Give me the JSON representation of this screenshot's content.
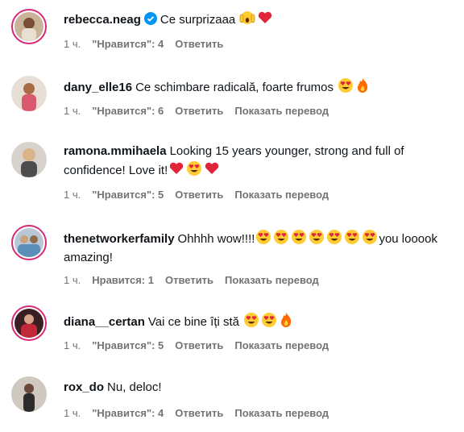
{
  "comments": [
    {
      "username": "rebecca.neag",
      "verified": true,
      "text": "Ce surprizaaa",
      "emojis": [
        "screaming-hands",
        "red-heart"
      ],
      "time": "1 ч.",
      "likes": "\"Нравится\": 4",
      "reply": "Ответить",
      "translate": ""
    },
    {
      "username": "dany_elle16",
      "text": "Ce schimbare radicală, foarte frumos",
      "emojis": [
        "heart-eyes",
        "fire"
      ],
      "time": "1 ч.",
      "likes": "\"Нравится\": 6",
      "reply": "Ответить",
      "translate": "Показать перевод"
    },
    {
      "username": "ramona.mmihaela",
      "text": "Looking 15 years younger, strong and full of confidence! Love it!",
      "emojis": [
        "red-heart",
        "heart-eyes",
        "red-heart"
      ],
      "time": "1 ч.",
      "likes": "\"Нравится\": 5",
      "reply": "Ответить",
      "translate": "Показать перевод"
    },
    {
      "username": "thenetworkerfamily",
      "text": "Ohhhh wow!!!!",
      "emojis": [
        "heart-eyes",
        "heart-eyes",
        "heart-eyes",
        "heart-eyes",
        "heart-eyes",
        "heart-eyes",
        "heart-eyes"
      ],
      "text_after": "you looook amazing!",
      "time": "1 ч.",
      "likes": "Нравится: 1",
      "reply": "Ответить",
      "translate": "Показать перевод"
    },
    {
      "username": "diana__certan",
      "text": "Vai ce bine îți stă",
      "emojis": [
        "heart-eyes",
        "heart-eyes",
        "fire"
      ],
      "time": "1 ч.",
      "likes": "\"Нравится\": 5",
      "reply": "Ответить",
      "translate": "Показать перевод"
    },
    {
      "username": "rox_do",
      "text": "Nu, deloc!",
      "emojis": [],
      "time": "1 ч.",
      "likes": "\"Нравится\": 4",
      "reply": "Ответить",
      "translate": "Показать перевод"
    }
  ],
  "colors": {
    "meta": "#737373",
    "ring": "#d62976",
    "verified": "#0095f6"
  }
}
